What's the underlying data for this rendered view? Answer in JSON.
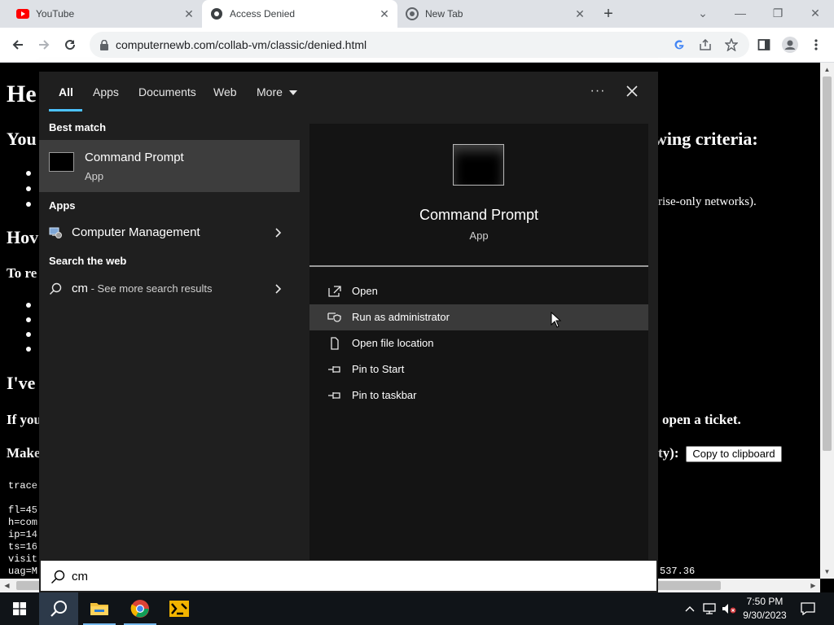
{
  "browser": {
    "tabs": [
      {
        "title": "YouTube",
        "active": false
      },
      {
        "title": "Access Denied",
        "active": true
      },
      {
        "title": "New Tab",
        "active": false
      }
    ],
    "url": "computernewb.com/collab-vm/classic/denied.html"
  },
  "page": {
    "heading_fragment": "He",
    "line1_left": "You",
    "line1_right": "wing criteria:",
    "bullet_right": "rise-only networks).",
    "heading2_fragment": "Hov",
    "para_fragment": "To re",
    "heading3_fragment": "I've",
    "ticket_left": "If you",
    "ticket_right": "open a ticket.",
    "make_left": "Make",
    "make_right": "ty):",
    "copy_button": "Copy to clipboard",
    "trace_lines": [
      "trace",
      "fl=45",
      "h=com",
      "ip=14",
      "ts=16",
      "visit",
      "uag=M"
    ],
    "trace_tail": "537.36"
  },
  "search": {
    "tabs": [
      "All",
      "Apps",
      "Documents",
      "Web",
      "More"
    ],
    "best_match_header": "Best match",
    "best_match": {
      "name": "Command Prompt",
      "type": "App"
    },
    "apps_header": "Apps",
    "apps": [
      {
        "name": "Computer Management"
      }
    ],
    "web_header": "Search the web",
    "web_query": "cm",
    "web_suffix": " - See more search results",
    "preview": {
      "name": "Command Prompt",
      "type": "App"
    },
    "actions": [
      "Open",
      "Run as administrator",
      "Open file location",
      "Pin to Start",
      "Pin to taskbar"
    ],
    "query": "cm"
  },
  "taskbar": {
    "time": "7:50 PM",
    "date": "9/30/2023"
  },
  "colors": {
    "accent": "#4cc2ff",
    "panel": "#1f1f1f",
    "highlight": "#3d3d3d",
    "taskbar": "#101418"
  }
}
